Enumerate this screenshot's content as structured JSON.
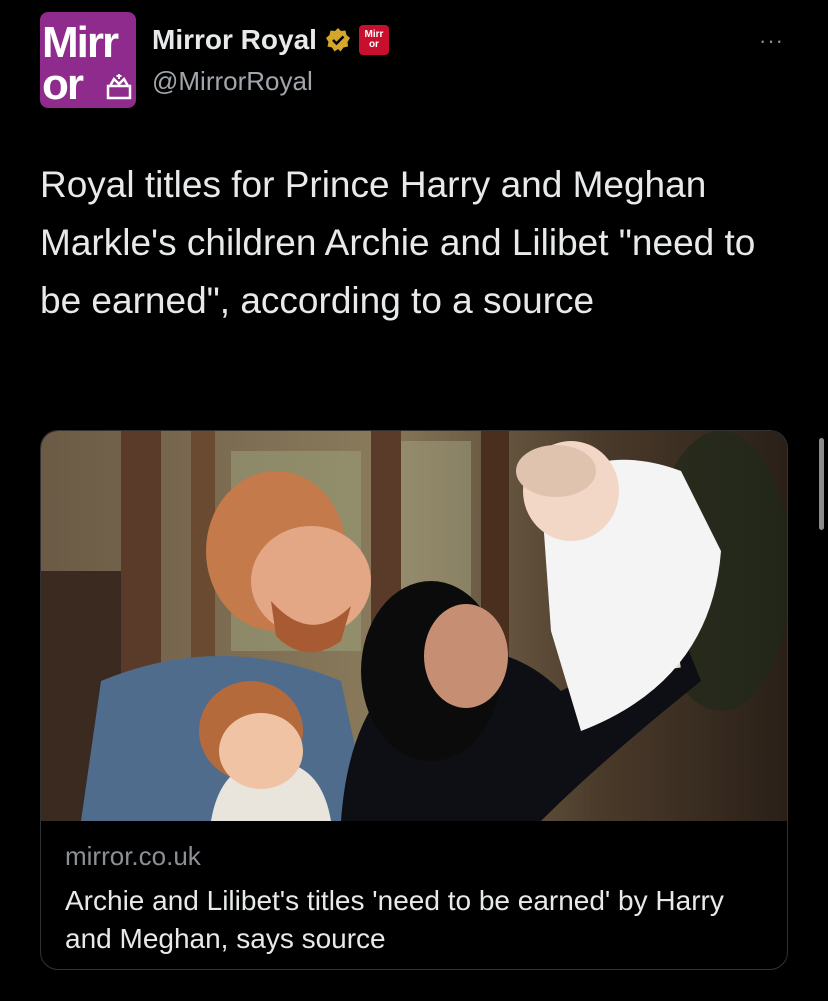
{
  "account": {
    "avatar_line1": "Mirr",
    "avatar_line2": "or",
    "name": "Mirror Royal",
    "handle": "@MirrorRoyal",
    "badge_line1": "Mirr",
    "badge_line2": "or"
  },
  "more_label": "···",
  "tweet": {
    "text": "Royal titles for Prince Harry and Meghan Markle's children Archie and Lilibet \"need to be earned\", according to a source"
  },
  "card": {
    "domain": "mirror.co.uk",
    "title": "Archie and Lilibet's titles 'need to be earned' by Harry and Meghan, says source"
  },
  "colors": {
    "background": "#000000",
    "avatar": "#8e2b8c",
    "verified": "#d4a72c",
    "badge": "#c8102e"
  },
  "icons": [
    "verified-badge-icon",
    "crown-icon",
    "more-icon"
  ]
}
